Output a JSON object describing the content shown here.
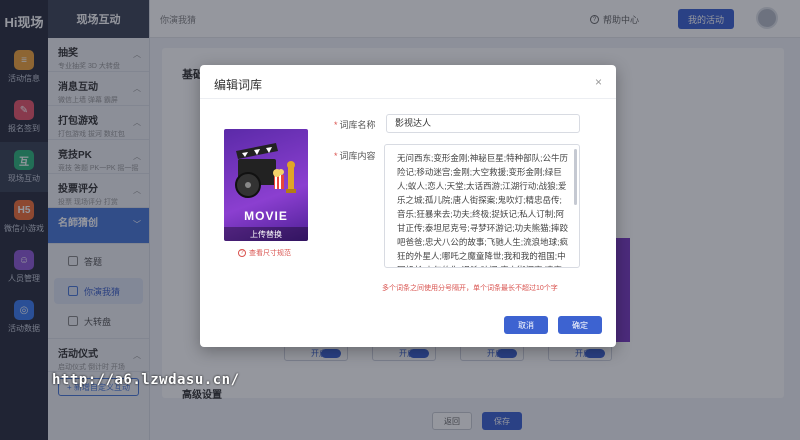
{
  "app": {
    "logo": "Hi现场"
  },
  "rail": [
    {
      "label": "活动信息",
      "icon": "info-icon",
      "color": "#f0a53c",
      "glyph": "≡"
    },
    {
      "label": "报名签到",
      "icon": "signin-icon",
      "color": "#e8566c",
      "glyph": "✎"
    },
    {
      "label": "现场互动",
      "icon": "interact-icon",
      "color": "#2fb57c",
      "glyph": "互"
    },
    {
      "label": "微信小游戏",
      "icon": "h5-icon",
      "color": "#f0703a",
      "glyph": "H5"
    },
    {
      "label": "人员管理",
      "icon": "people-icon",
      "color": "#8f59d6",
      "glyph": "☺"
    },
    {
      "label": "活动数据",
      "icon": "data-icon",
      "color": "#3d7cf0",
      "glyph": "◎"
    }
  ],
  "subnav": {
    "header": "现场互动",
    "groups": [
      {
        "title": "抽奖",
        "sub": "专业抽奖 3D 大转盘"
      },
      {
        "title": "消息互动",
        "sub": "微信上墙 弹幕 霸屏"
      },
      {
        "title": "打包游戏",
        "sub": "打包游戏 拔河 数红包"
      },
      {
        "title": "竞技PK",
        "sub": "竞技 答题 PK一PK 摇一摇"
      },
      {
        "title": "投票评分",
        "sub": "投票 现场评分 打赏"
      },
      {
        "title": "名師猜创",
        "sub": ""
      }
    ],
    "items": [
      {
        "label": "答题",
        "active": false
      },
      {
        "label": "你演我猜",
        "active": true
      },
      {
        "label": "大转盘",
        "active": false
      }
    ],
    "bottom_group": {
      "title": "活动仪式",
      "sub": "启动仪式 倒计时 开场"
    },
    "add_label": "+ 新增自定义互动"
  },
  "topbar": {
    "breadcrumb": "你演我猜",
    "help": "帮助中心",
    "my_activity": "我的活动"
  },
  "main": {
    "base_label": "基础",
    "advanced_label": "高级设置",
    "toggle_label": "开启",
    "back_label": "返回",
    "save_label": "保存"
  },
  "dialog": {
    "title": "编辑词库",
    "close": "×",
    "cover_text": "MOVIE",
    "cover_upload": "上传替换",
    "size_link": "查看尺寸规范",
    "name_label": "词库名称",
    "name_value": "影视达人",
    "content_label": "词库内容",
    "content_value": "无问西东;变形金刚;神秘巨星;特种部队;公牛历险记;移动迷宫;金刚;大空救援;变形金刚;绿巨人;蚁人;恋人;天堂;太话西游;江湖行动;战狼;爱乐之城;孤儿院;唐人街探案;鬼吹灯;精忠岳传;音乐;狂暴来去;功夫;终极;捉妖记;私人订制;阿甘正传;泰坦尼克号;寻梦环游记;功夫熊猫;摔跤吧爸爸;忠犬八公的故事;飞驰人生;流浪地球;疯狂的外星人;哪吒之魔童降世;我和我的祖国;中国机长;少年的你;误杀;叶问;唐人街探案;速度与激情;复仇者联盟;蜘蛛侠;海王;头号玩家;心花路放;西红柿首富;夏洛特烦恼;战狼;红海行动;长津湖;你好李焕英",
    "hint": "多个词条之间使用分号隔开，单个词条最长不超过10个字",
    "cancel": "取消",
    "ok": "确定"
  },
  "watermark": "http://a6.lzwdasu.cn/"
}
